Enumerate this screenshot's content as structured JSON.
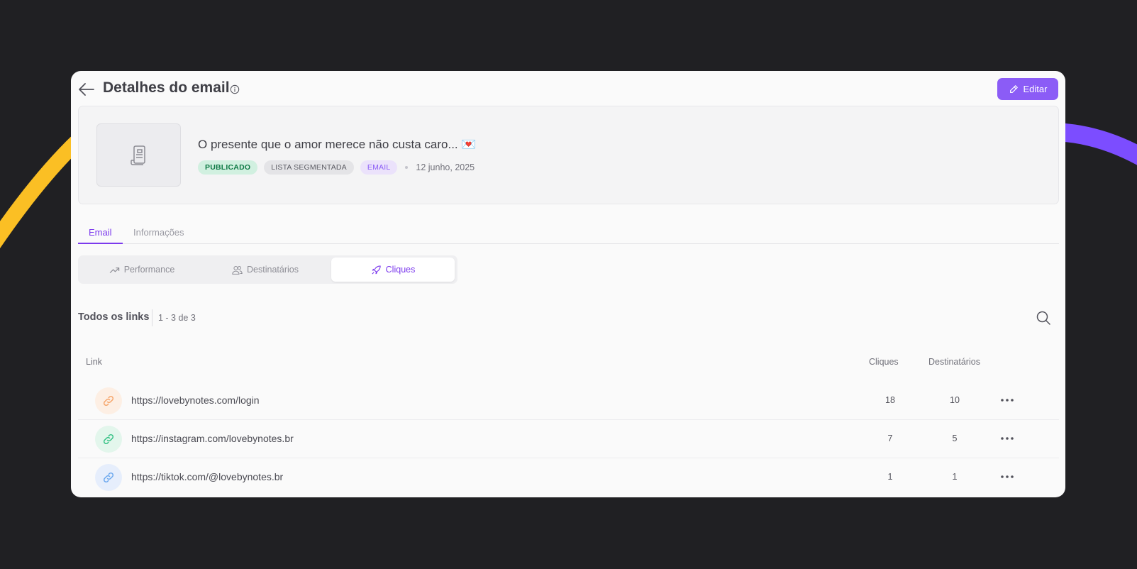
{
  "header": {
    "title": "Detalhes do email",
    "edit_label": "Editar"
  },
  "email": {
    "subject": "O presente que o amor merece não custa caro... 💌",
    "status_badge": "PUBLICADO",
    "list_badge": "LISTA SEGMENTADA",
    "type_badge": "EMAIL",
    "date": "12 junho, 2025"
  },
  "tabs": [
    {
      "label": "Email",
      "active": true
    },
    {
      "label": "Informações",
      "active": false
    }
  ],
  "segments": [
    {
      "label": "Performance",
      "icon": "trending-up-icon",
      "active": false
    },
    {
      "label": "Destinatários",
      "icon": "users-icon",
      "active": false
    },
    {
      "label": "Cliques",
      "icon": "rocket-icon",
      "active": true
    }
  ],
  "links": {
    "title": "Todos os links",
    "count": "1 - 3 de 3",
    "columns": {
      "link": "Link",
      "clicks": "Cliques",
      "recipients": "Destinatários"
    },
    "rows": [
      {
        "url": "https://lovebynotes.com/login",
        "clicks": "18",
        "recipients": "10",
        "icon_color": "#f6a56a",
        "icon_bg": "#fdefe4"
      },
      {
        "url": "https://instagram.com/lovebynotes.br",
        "clicks": "7",
        "recipients": "5",
        "icon_color": "#34c184",
        "icon_bg": "#e3f6ec"
      },
      {
        "url": "https://tiktok.com/@lovebynotes.br",
        "clicks": "1",
        "recipients": "1",
        "icon_color": "#6aa7ee",
        "icon_bg": "#e6eefc"
      }
    ]
  },
  "colors": {
    "accent": "#8b5cf6",
    "background": "#202023",
    "deco_yellow": "#fbbf24",
    "deco_purple": "#7c4dff"
  }
}
